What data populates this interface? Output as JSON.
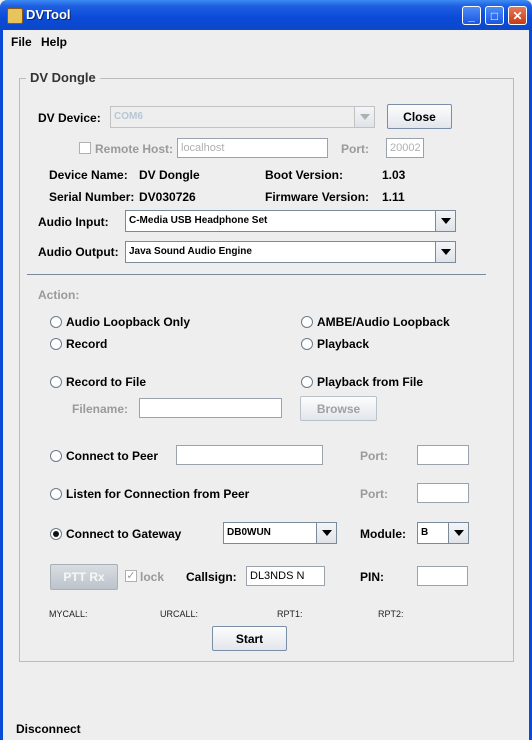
{
  "window": {
    "title": "DVTool",
    "minimize_glyph": "_",
    "maximize_glyph": "□",
    "close_glyph": "✕"
  },
  "menu": {
    "file": "File",
    "help": "Help"
  },
  "group": {
    "title": "DV Dongle",
    "dv_device_label": "DV Device:",
    "dv_device_value": "COM6",
    "close_button": "Close",
    "remote_host_label": "Remote Host:",
    "remote_host_value": "localhost",
    "remote_port_label": "Port:",
    "remote_port_value": "20002",
    "device_name_label": "Device Name:",
    "device_name_value": "DV Dongle",
    "boot_version_label": "Boot Version:",
    "boot_version_value": "1.03",
    "serial_label": "Serial Number:",
    "serial_value": "DV030726",
    "firmware_label": "Firmware Version:",
    "firmware_value": "1.11",
    "audio_input_label": "Audio Input:",
    "audio_input_value": "C-Media USB Headphone Set",
    "audio_output_label": "Audio Output:",
    "audio_output_value": "Java Sound Audio Engine"
  },
  "action": {
    "label": "Action:",
    "audio_loopback": "Audio Loopback Only",
    "ambe_loopback": "AMBE/Audio Loopback",
    "record": "Record",
    "playback": "Playback",
    "record_to_file": "Record to File",
    "playback_from_file": "Playback from File",
    "filename_label": "Filename:",
    "filename_value": "",
    "browse_button": "Browse",
    "connect_peer": "Connect to Peer",
    "peer_host_value": "",
    "peer_port_label": "Port:",
    "peer_port_value": "",
    "listen_peer": "Listen for Connection from Peer",
    "listen_port_label": "Port:",
    "listen_port_value": "",
    "connect_gateway": "Connect to Gateway",
    "gateway_value": "DB0WUN",
    "module_label": "Module:",
    "module_value": "B",
    "ptt_button": "PTT Rx",
    "lock_label": "lock",
    "lock_glyph": "✓",
    "callsign_label": "Callsign:",
    "callsign_value": "DL3NDS N",
    "pin_label": "PIN:",
    "pin_value": "",
    "mycall": "MYCALL:",
    "urcall": "URCALL:",
    "rpt1": "RPT1:",
    "rpt2": "RPT2:",
    "start_button": "Start"
  },
  "status": {
    "text": "Disconnect"
  },
  "colors": {
    "titlebar": "#0a4ad8",
    "background": "#eeeeee"
  }
}
